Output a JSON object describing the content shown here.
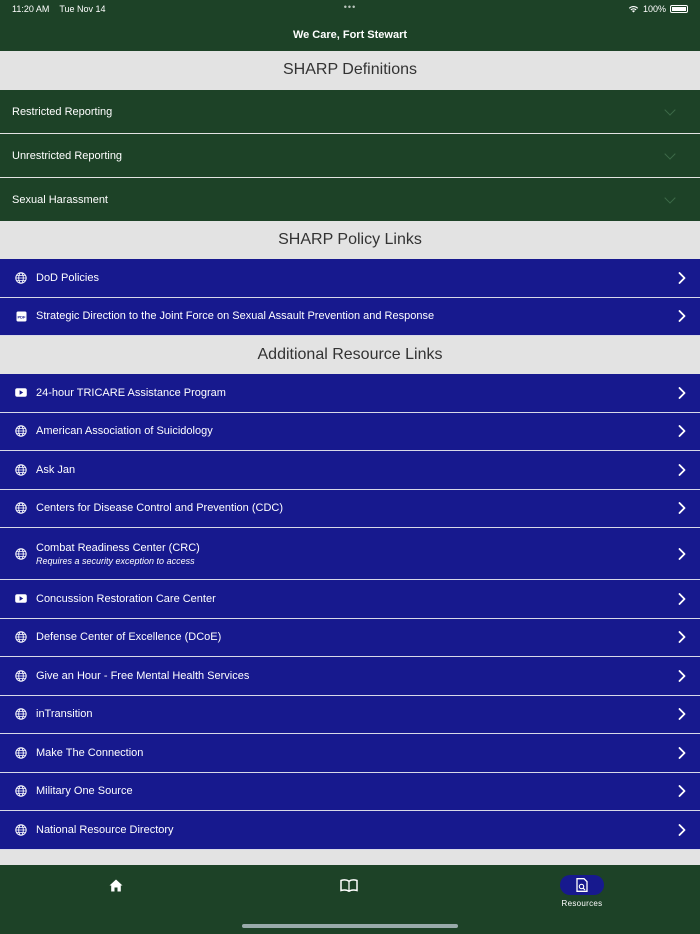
{
  "status_bar": {
    "time": "11:20 AM",
    "date": "Tue Nov 14",
    "battery": "100%"
  },
  "nav": {
    "title": "We Care, Fort Stewart"
  },
  "definitions": {
    "header": "SHARP Definitions",
    "items": [
      {
        "label": "Restricted Reporting"
      },
      {
        "label": "Unrestricted Reporting"
      },
      {
        "label": "Sexual Harassment"
      }
    ]
  },
  "policy": {
    "header": "SHARP Policy Links",
    "items": [
      {
        "label": "DoD Policies",
        "icon": "globe-icon"
      },
      {
        "label": "Strategic Direction to the Joint Force on Sexual Assault Prevention and Response",
        "icon": "pdf-icon"
      }
    ]
  },
  "additional": {
    "header": "Additional Resource Links",
    "items": [
      {
        "label": "24-hour TRICARE Assistance Program",
        "icon": "video-icon"
      },
      {
        "label": "American Association of Suicidology",
        "icon": "globe-icon"
      },
      {
        "label": "Ask Jan",
        "icon": "globe-icon"
      },
      {
        "label": "Centers for Disease Control and Prevention (CDC)",
        "icon": "globe-icon"
      },
      {
        "label": "Combat Readiness Center (CRC)",
        "sub": "Requires a security exception to access",
        "icon": "globe-icon"
      },
      {
        "label": "Concussion Restoration Care Center",
        "icon": "video-icon"
      },
      {
        "label": "Defense Center of Excellence (DCoE)",
        "icon": "globe-icon"
      },
      {
        "label": "Give an Hour - Free Mental Health Services",
        "icon": "globe-icon"
      },
      {
        "label": "inTransition",
        "icon": "globe-icon"
      },
      {
        "label": "Make The Connection",
        "icon": "globe-icon"
      },
      {
        "label": "Military One Source",
        "icon": "globe-icon"
      },
      {
        "label": "National Resource Directory",
        "icon": "globe-icon"
      }
    ]
  },
  "tabs": [
    {
      "name": "home",
      "icon": "home-icon",
      "label": ""
    },
    {
      "name": "book",
      "icon": "book-icon",
      "label": ""
    },
    {
      "name": "resources",
      "icon": "resources-icon",
      "label": "Resources",
      "active": true
    }
  ],
  "colors": {
    "green": "#1d4227",
    "blue": "#17198e",
    "gray": "#e3e3e3"
  }
}
